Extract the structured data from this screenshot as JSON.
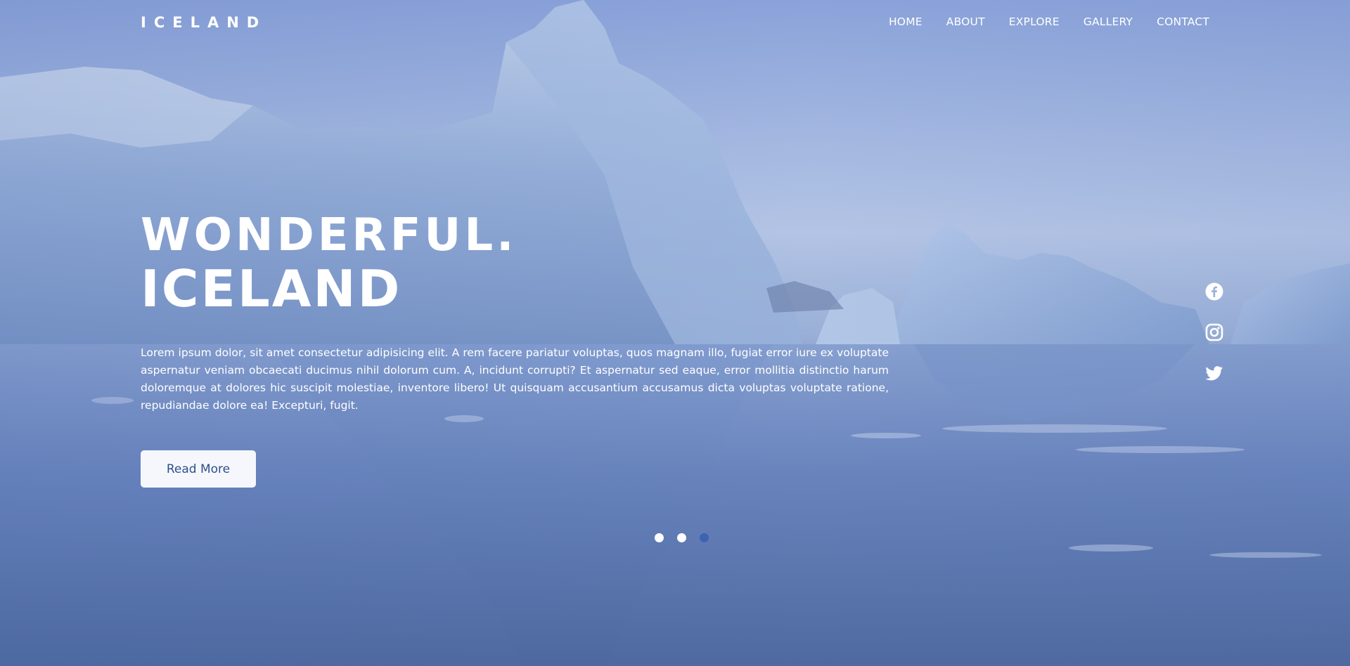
{
  "header": {
    "logo": "ICELAND",
    "nav": [
      "HOME",
      "ABOUT",
      "EXPLORE",
      "GALLERY",
      "CONTACT"
    ]
  },
  "hero": {
    "title_line1": "WONDERFUL.",
    "title_line2": "ICELAND",
    "description": "Lorem ipsum dolor, sit amet consectetur adipisicing elit. A rem facere pariatur voluptas, quos magnam illo, fugiat error iure ex voluptate aspernatur veniam obcaecati ducimus nihil dolorum cum. A, incidunt corrupti? Et aspernatur sed eaque, error mollitia distinctio harum doloremque at dolores hic suscipit molestiae, inventore libero! Ut quisquam accusantium accusamus dicta voluptas voluptate ratione, repudiandae dolore ea! Excepturi, fugit.",
    "button_label": "Read More"
  },
  "social_icons": [
    "facebook-icon",
    "instagram-icon",
    "twitter-icon"
  ],
  "slider": {
    "count": 3,
    "active_index": 2
  },
  "colors": {
    "text": "#ffffff",
    "button_text": "#2e4f8c",
    "active_dot": "#3f63b3"
  }
}
